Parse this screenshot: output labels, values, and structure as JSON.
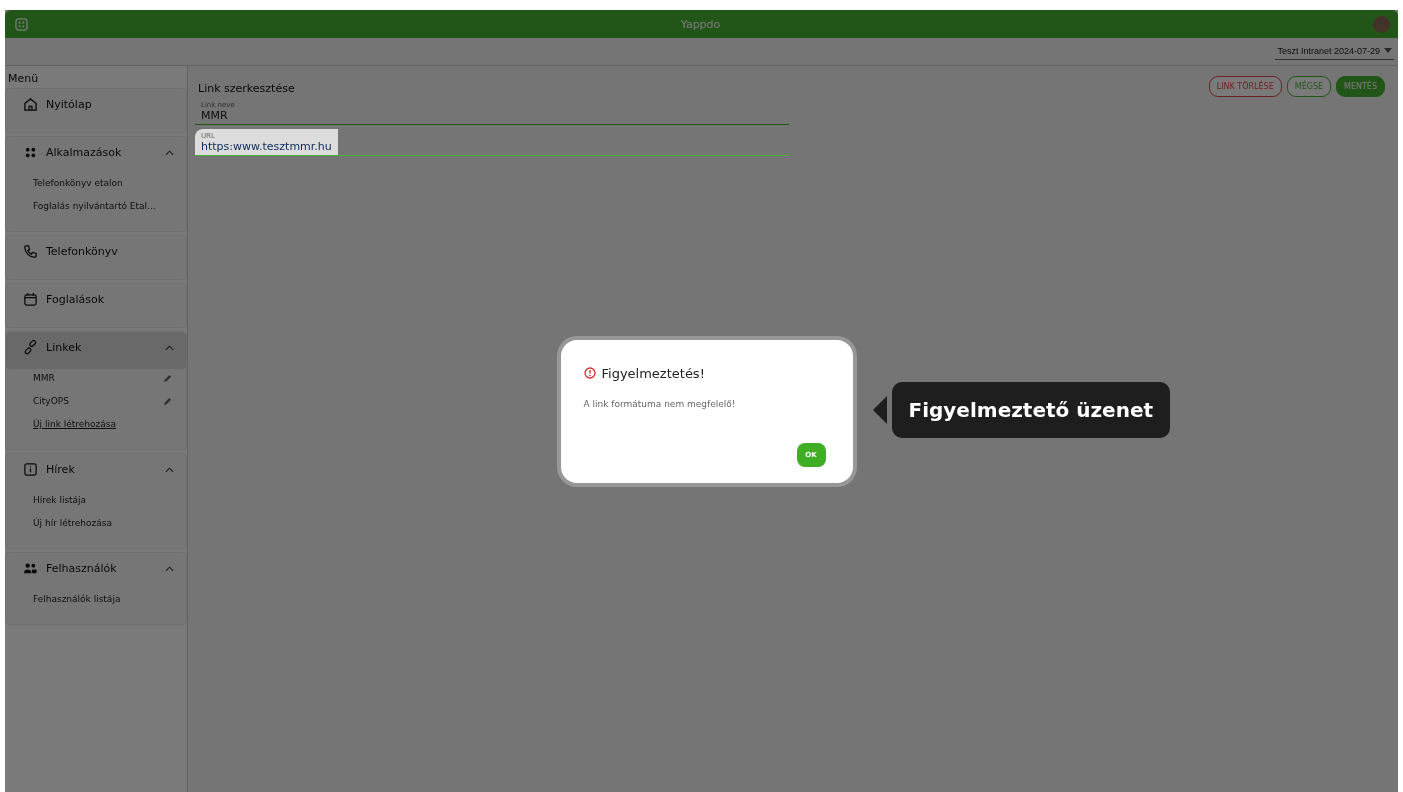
{
  "app_bar": {
    "title": "Yappdo"
  },
  "toolbar": {
    "workspace_select": "Teszt Intranet 2024-07-29"
  },
  "sidebar": {
    "title": "Menü",
    "sections": [
      {
        "label": "Nyitólap",
        "selected": false
      },
      {
        "label": "Alkalmazások",
        "expanded": true,
        "selected": false,
        "children": [
          {
            "label": "Telefonkönyv etalon",
            "kind": "plain"
          },
          {
            "label": "Foglalás nyilvántartó Etal...",
            "kind": "plain"
          }
        ]
      },
      {
        "label": "Telefonkönyv",
        "selected": false
      },
      {
        "label": "Foglalások",
        "selected": false
      },
      {
        "label": "Linkek",
        "expanded": true,
        "selected": true,
        "children": [
          {
            "label": "MMR",
            "kind": "edit"
          },
          {
            "label": "CityOPS",
            "kind": "edit"
          },
          {
            "label": "Új link létrehozása",
            "kind": "create"
          }
        ]
      },
      {
        "label": "Hírek",
        "expanded": true,
        "selected": false,
        "children": [
          {
            "label": "Hírek listája",
            "kind": "plain"
          },
          {
            "label": "Új hír létrehozása",
            "kind": "plain"
          }
        ]
      },
      {
        "label": "Felhasználók",
        "expanded": true,
        "selected": false,
        "children": [
          {
            "label": "Felhasználók listája",
            "kind": "plain"
          }
        ]
      }
    ]
  },
  "form": {
    "title": "Link szerkesztése",
    "buttons": [
      {
        "label": "LINK TÖRLÉSE",
        "kind": "danger"
      },
      {
        "label": "MÉGSE",
        "kind": "outline"
      },
      {
        "label": "MENTÉS",
        "kind": "primary"
      }
    ],
    "fields": [
      {
        "label": "Link neve",
        "value": "MMR",
        "highlighted": false
      },
      {
        "label": "URL",
        "value": "https:www.tesztmmr.hu",
        "highlighted": true
      }
    ]
  },
  "dialog": {
    "title": "Figyelmeztetés!",
    "message": "A link formátuma nem megfelelő!",
    "button": "OK"
  },
  "callout": {
    "text": "Figyelmeztető üzenet"
  }
}
